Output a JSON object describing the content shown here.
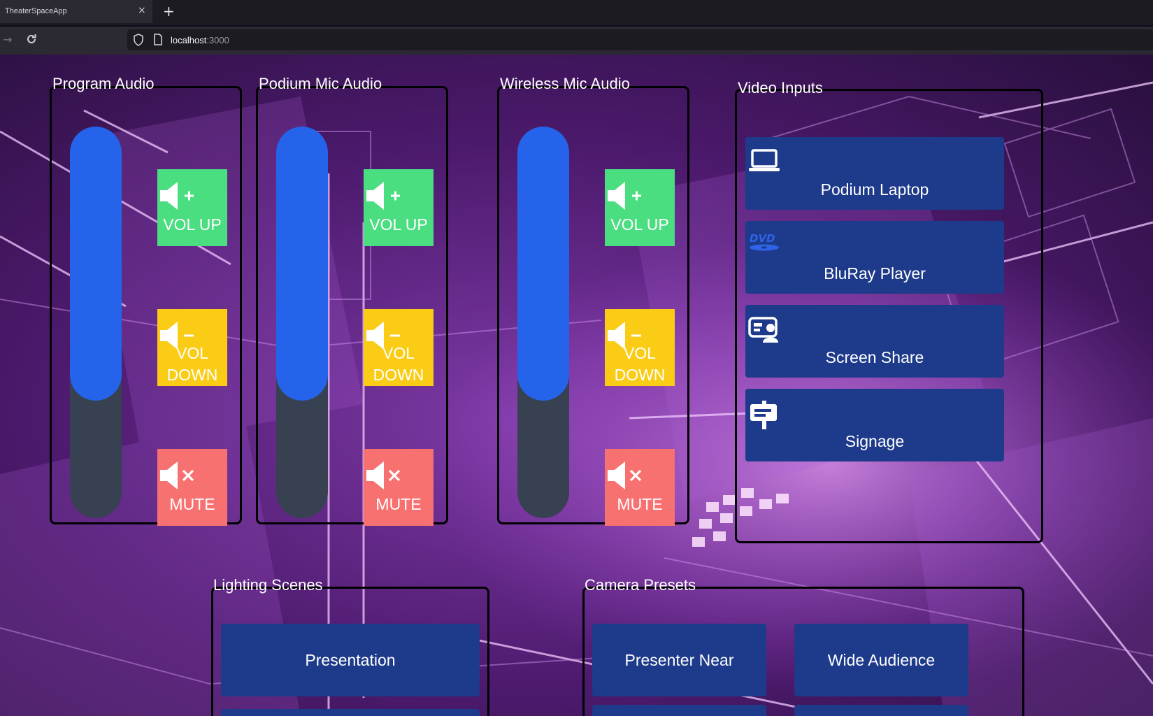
{
  "browser": {
    "tab_title": "TheaterSpaceApp",
    "tab_close": "×",
    "new_tab": "+",
    "url_host": "localhost",
    "url_port": ":3000"
  },
  "audio_panels": [
    {
      "title": "Program Audio",
      "level_percent": 70,
      "vol_up": "VOL UP",
      "vol_down": "VOL DOWN",
      "mute": "MUTE"
    },
    {
      "title": "Podium Mic Audio",
      "level_percent": 70,
      "vol_up": "VOL UP",
      "vol_down": "VOL DOWN",
      "mute": "MUTE"
    },
    {
      "title": "Wireless Mic Audio",
      "level_percent": 70,
      "vol_up": "VOL UP",
      "vol_down": "VOL DOWN",
      "mute": "MUTE"
    }
  ],
  "video_inputs": {
    "title": "Video Inputs",
    "sources": [
      {
        "label": "Podium Laptop",
        "icon": "laptop-icon"
      },
      {
        "label": "BluRay Player",
        "icon": "dvd-icon"
      },
      {
        "label": "Screen Share",
        "icon": "screen-share-icon"
      },
      {
        "label": "Signage",
        "icon": "signage-icon"
      }
    ]
  },
  "lighting": {
    "title": "Lighting Scenes",
    "scenes": [
      "Presentation"
    ]
  },
  "camera": {
    "title": "Camera Presets",
    "presets": [
      "Presenter Near",
      "Wide Audience"
    ]
  },
  "colors": {
    "button_blue": "#1e3a8a",
    "slider_fill": "#2563eb",
    "slider_track": "#374151",
    "vol_up": "#4ade80",
    "vol_down": "#facc15",
    "mute": "#f87171"
  }
}
